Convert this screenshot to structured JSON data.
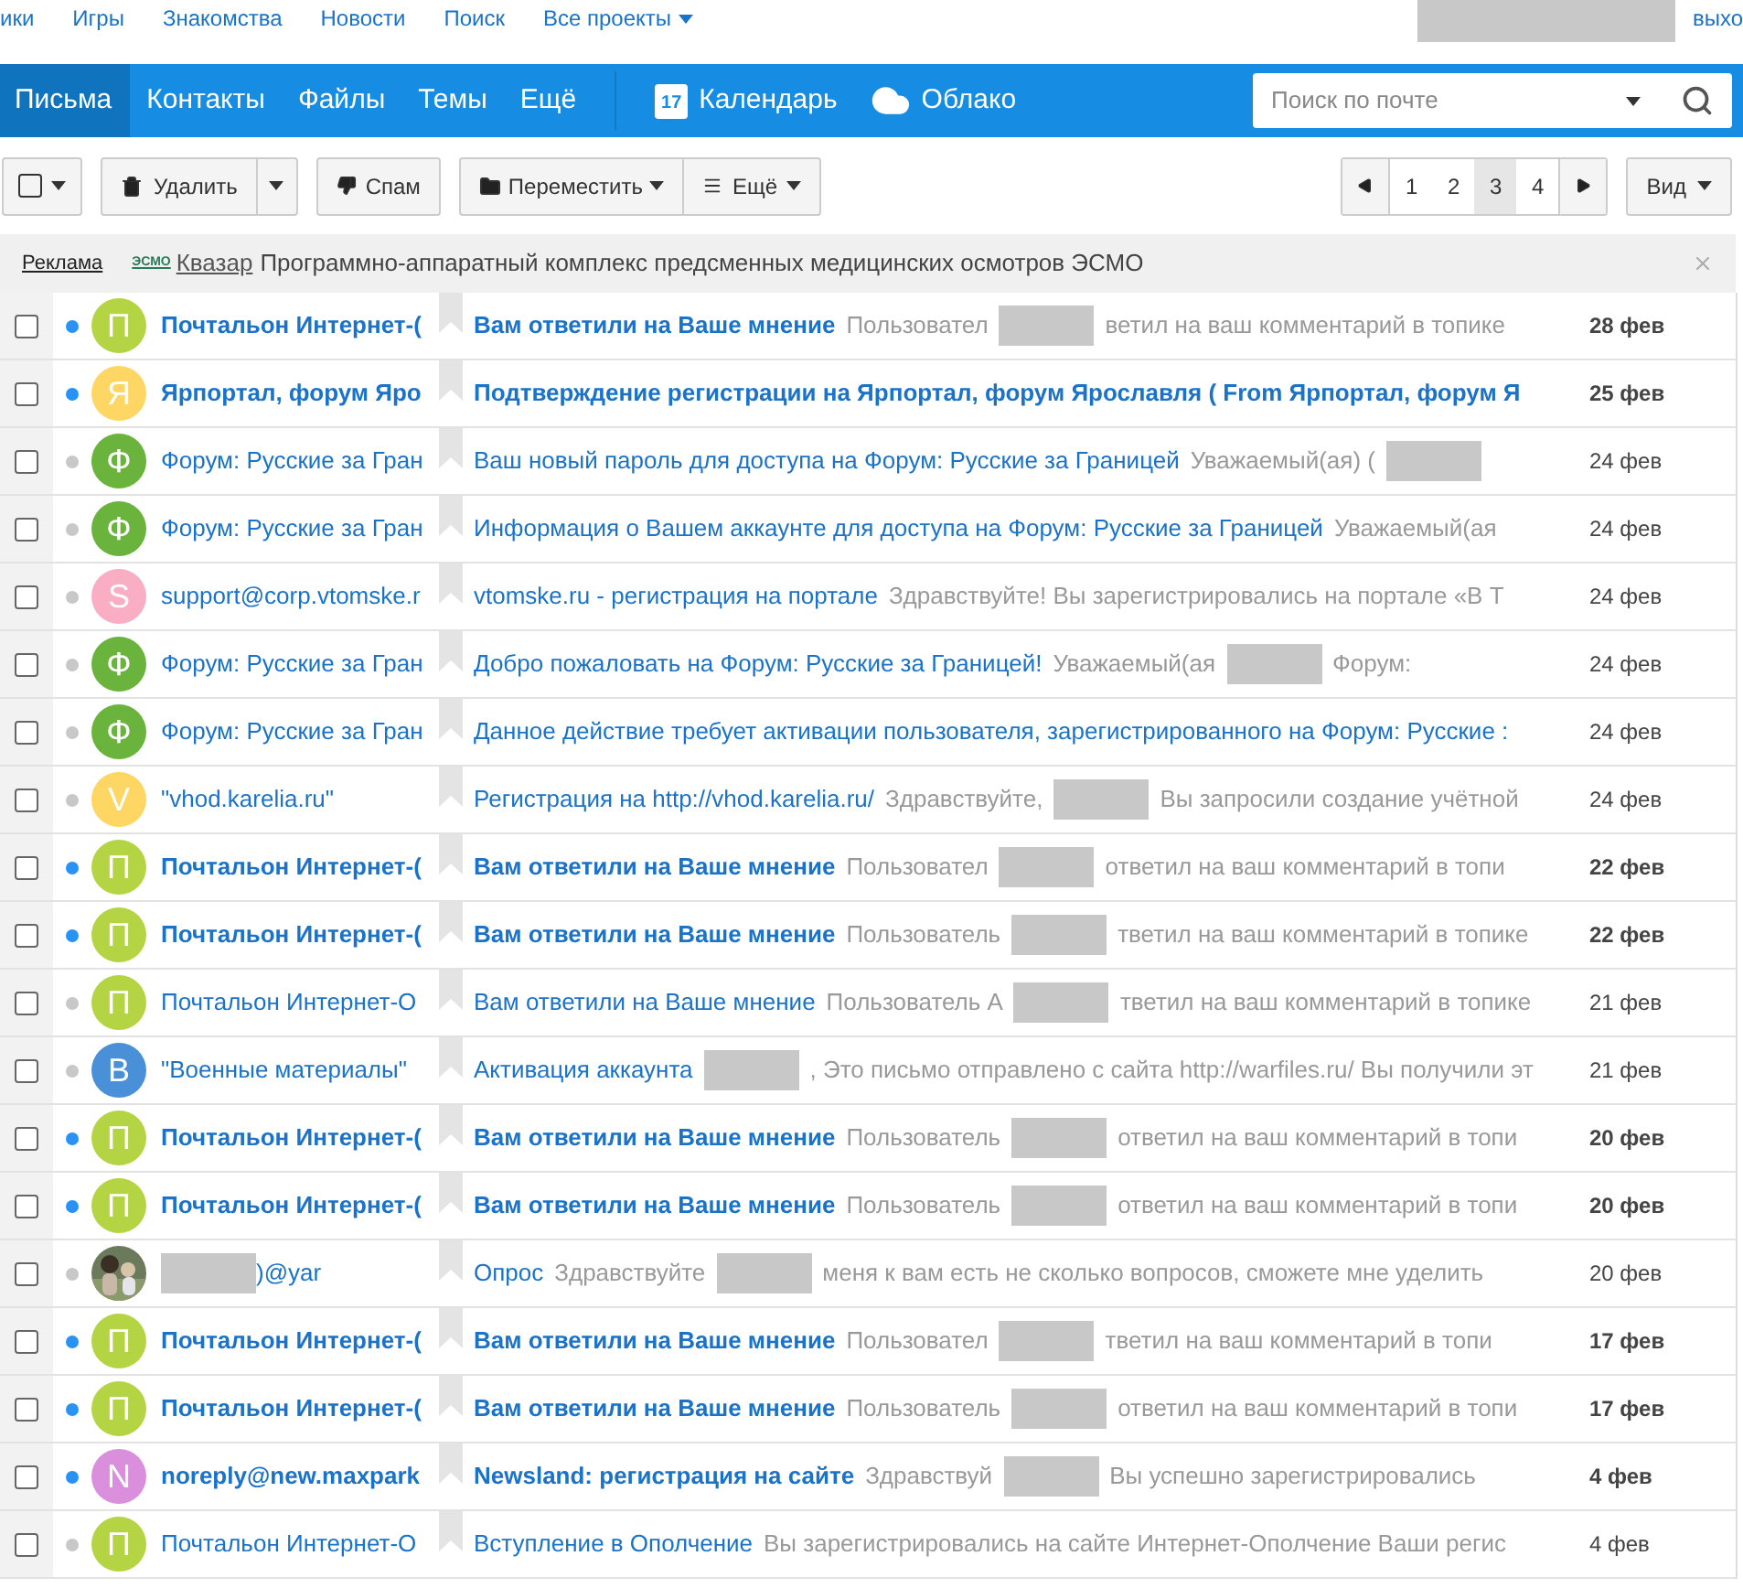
{
  "top_links": [
    "ики",
    "Игры",
    "Знакомства",
    "Новости",
    "Поиск"
  ],
  "all_projects": "Все проекты",
  "logout": "выхо",
  "nav": [
    {
      "label": "Письма",
      "selected": true
    },
    {
      "label": "Контакты",
      "selected": false
    },
    {
      "label": "Файлы",
      "selected": false
    },
    {
      "label": "Темы",
      "selected": false
    },
    {
      "label": "Ещё",
      "selected": false
    }
  ],
  "calendar": {
    "day": "17",
    "label": "Календарь"
  },
  "cloud": "Облако",
  "search": {
    "placeholder": "Поиск по почте"
  },
  "toolbar": {
    "delete": "Удалить",
    "spam": "Спам",
    "move": "Переместить",
    "more": "Ещё",
    "view": "Вид"
  },
  "pages": [
    {
      "label": "1",
      "selected": false
    },
    {
      "label": "2",
      "selected": false
    },
    {
      "label": "3",
      "selected": true
    },
    {
      "label": "4",
      "selected": false
    }
  ],
  "ad": {
    "label": "Реклама",
    "logo": "ЭСМО",
    "link": "Квазар",
    "text": "Программно-аппаратный комплекс предсменных медицинских осмотров ЭСМО"
  },
  "messages": [
    {
      "checked": false,
      "unread": true,
      "avatar": {
        "kind": "letter",
        "letter": "П",
        "color": "#b5d443"
      },
      "sender": [
        {
          "kind": "text",
          "text": "Почтальон Интернет-("
        }
      ],
      "subject": "Вам ответили на Ваше мнение",
      "preview": [
        {
          "kind": "text",
          "text": "Пользовател"
        },
        {
          "kind": "redacted"
        },
        {
          "kind": "text",
          "text": "ветил на ваш комментарий в топике"
        }
      ],
      "date": "28 фев"
    },
    {
      "checked": false,
      "unread": true,
      "avatar": {
        "kind": "letter",
        "letter": "Я",
        "color": "#fdd663"
      },
      "sender": [
        {
          "kind": "text",
          "text": "Ярпортал, форум Яро"
        }
      ],
      "subject": "Подтверждение регистрации на Ярпортал, форум Ярославля ( From Ярпортал, форум Я",
      "date": "25 фев"
    },
    {
      "checked": false,
      "unread": false,
      "avatar": {
        "kind": "letter",
        "letter": "Ф",
        "color": "#6ab43e"
      },
      "sender": [
        {
          "kind": "text",
          "text": "Форум: Русские за Гран"
        }
      ],
      "subject": "Ваш новый пароль для доступа на Форум: Русские за Границей",
      "preview": [
        {
          "kind": "text",
          "text": "Уважаемый(ая) ("
        },
        {
          "kind": "redacted"
        }
      ],
      "date": "24 фев"
    },
    {
      "checked": false,
      "unread": false,
      "avatar": {
        "kind": "letter",
        "letter": "Ф",
        "color": "#6ab43e"
      },
      "sender": [
        {
          "kind": "text",
          "text": "Форум: Русские за Гран"
        }
      ],
      "subject": "Информация о Вашем аккаунте для доступа на Форум: Русские за Границей",
      "preview": [
        {
          "kind": "text",
          "text": "Уважаемый(ая"
        }
      ],
      "date": "24 фев"
    },
    {
      "checked": false,
      "unread": false,
      "avatar": {
        "kind": "letter",
        "letter": "S",
        "color": "#f9aec4"
      },
      "sender": [
        {
          "kind": "text",
          "text": "support@corp.vtomske.r"
        }
      ],
      "subject": "vtomske.ru - регистрация на портале",
      "preview": [
        {
          "kind": "text",
          "text": "Здравствуйте! Вы зарегистрировались на портале «В Т"
        }
      ],
      "date": "24 фев"
    },
    {
      "checked": false,
      "unread": false,
      "avatar": {
        "kind": "letter",
        "letter": "Ф",
        "color": "#6ab43e"
      },
      "sender": [
        {
          "kind": "text",
          "text": "Форум: Русские за Гран"
        }
      ],
      "subject": "Добро пожаловать на Форум: Русские за Границей!",
      "preview": [
        {
          "kind": "text",
          "text": "Уважаемый(ая"
        },
        {
          "kind": "redacted"
        },
        {
          "kind": "text",
          "text": "Форум:"
        }
      ],
      "date": "24 фев"
    },
    {
      "checked": false,
      "unread": false,
      "avatar": {
        "kind": "letter",
        "letter": "Ф",
        "color": "#6ab43e"
      },
      "sender": [
        {
          "kind": "text",
          "text": "Форум: Русские за Гран"
        }
      ],
      "subject": "Данное действие требует активации пользователя, зарегистрированного на Форум: Русские :",
      "date": "24 фев"
    },
    {
      "checked": false,
      "unread": false,
      "avatar": {
        "kind": "letter",
        "letter": "V",
        "color": "#fdd663"
      },
      "sender": [
        {
          "kind": "text",
          "text": "\"vhod.karelia.ru\""
        }
      ],
      "subject": "Регистрация на http://vhod.karelia.ru/",
      "preview": [
        {
          "kind": "text",
          "text": "Здравствуйте,"
        },
        {
          "kind": "redacted"
        },
        {
          "kind": "text",
          "text": "Вы запросили создание учётной"
        }
      ],
      "date": "24 фев"
    },
    {
      "checked": false,
      "unread": true,
      "avatar": {
        "kind": "letter",
        "letter": "П",
        "color": "#b5d443"
      },
      "sender": [
        {
          "kind": "text",
          "text": "Почтальон Интернет-("
        }
      ],
      "subject": "Вам ответили на Ваше мнение",
      "preview": [
        {
          "kind": "text",
          "text": "Пользовател"
        },
        {
          "kind": "redacted"
        },
        {
          "kind": "text",
          "text": "ответил на ваш комментарий в топи"
        }
      ],
      "date": "22 фев"
    },
    {
      "checked": false,
      "unread": true,
      "avatar": {
        "kind": "letter",
        "letter": "П",
        "color": "#b5d443"
      },
      "sender": [
        {
          "kind": "text",
          "text": "Почтальон Интернет-("
        }
      ],
      "subject": "Вам ответили на Ваше мнение",
      "preview": [
        {
          "kind": "text",
          "text": "Пользователь"
        },
        {
          "kind": "redacted"
        },
        {
          "kind": "text",
          "text": "тветил на ваш комментарий в топике"
        }
      ],
      "date": "22 фев"
    },
    {
      "checked": false,
      "unread": false,
      "avatar": {
        "kind": "letter",
        "letter": "П",
        "color": "#b5d443"
      },
      "sender": [
        {
          "kind": "text",
          "text": "Почтальон Интернет-О"
        }
      ],
      "subject": "Вам ответили на Ваше мнение",
      "preview": [
        {
          "kind": "text",
          "text": "Пользователь А"
        },
        {
          "kind": "redacted"
        },
        {
          "kind": "text",
          "text": "тветил на ваш комментарий в топике"
        }
      ],
      "date": "21 фев"
    },
    {
      "checked": false,
      "unread": false,
      "avatar": {
        "kind": "letter",
        "letter": "В",
        "color": "#4a90d9"
      },
      "sender": [
        {
          "kind": "text",
          "text": "\"Военные материалы\""
        }
      ],
      "subject": "Активация аккаунта",
      "preview": [
        {
          "kind": "redacted"
        },
        {
          "kind": "text",
          "text": ", Это письмо отправлено с сайта http://warfiles.ru/ Вы получили эт"
        }
      ],
      "date": "21 фев"
    },
    {
      "checked": false,
      "unread": true,
      "avatar": {
        "kind": "letter",
        "letter": "П",
        "color": "#b5d443"
      },
      "sender": [
        {
          "kind": "text",
          "text": "Почтальон Интернет-("
        }
      ],
      "subject": "Вам ответили на Ваше мнение",
      "preview": [
        {
          "kind": "text",
          "text": "Пользователь"
        },
        {
          "kind": "redacted"
        },
        {
          "kind": "text",
          "text": "ответил на ваш комментарий в топи"
        }
      ],
      "date": "20 фев"
    },
    {
      "checked": false,
      "unread": true,
      "avatar": {
        "kind": "letter",
        "letter": "П",
        "color": "#b5d443"
      },
      "sender": [
        {
          "kind": "text",
          "text": "Почтальон Интернет-("
        }
      ],
      "subject": "Вам ответили на Ваше мнение",
      "preview": [
        {
          "kind": "text",
          "text": "Пользователь"
        },
        {
          "kind": "redacted"
        },
        {
          "kind": "text",
          "text": "ответил на ваш комментарий в топи"
        }
      ],
      "date": "20 фев"
    },
    {
      "checked": false,
      "unread": false,
      "avatar": {
        "kind": "picture"
      },
      "sender": [
        {
          "kind": "redacted"
        },
        {
          "kind": "text",
          "text": ")@yar"
        }
      ],
      "subject": "Опрос",
      "preview": [
        {
          "kind": "text",
          "text": "Здравствуйте"
        },
        {
          "kind": "redacted"
        },
        {
          "kind": "text",
          "text": "меня к вам есть не сколько вопросов, сможете мне уделить"
        }
      ],
      "date": "20 фев"
    },
    {
      "checked": false,
      "unread": true,
      "avatar": {
        "kind": "letter",
        "letter": "П",
        "color": "#b5d443"
      },
      "sender": [
        {
          "kind": "text",
          "text": "Почтальон Интернет-("
        }
      ],
      "subject": "Вам ответили на Ваше мнение",
      "preview": [
        {
          "kind": "text",
          "text": "Пользовател"
        },
        {
          "kind": "redacted"
        },
        {
          "kind": "text",
          "text": "тветил на ваш комментарий в топи"
        }
      ],
      "date": "17 фев"
    },
    {
      "checked": false,
      "unread": true,
      "avatar": {
        "kind": "letter",
        "letter": "П",
        "color": "#b5d443"
      },
      "sender": [
        {
          "kind": "text",
          "text": "Почтальон Интернет-("
        }
      ],
      "subject": "Вам ответили на Ваше мнение",
      "preview": [
        {
          "kind": "text",
          "text": "Пользователь"
        },
        {
          "kind": "redacted"
        },
        {
          "kind": "text",
          "text": "ответил на ваш комментарий в топи"
        }
      ],
      "date": "17 фев"
    },
    {
      "checked": false,
      "unread": true,
      "avatar": {
        "kind": "letter",
        "letter": "N",
        "color": "#d98fdc"
      },
      "sender": [
        {
          "kind": "text",
          "text": "noreply@new.maxpark"
        }
      ],
      "subject": "Newsland: регистрация на сайте",
      "preview": [
        {
          "kind": "text",
          "text": "Здравствуй"
        },
        {
          "kind": "redacted"
        },
        {
          "kind": "text",
          "text": "Вы успешно зарегистрировались"
        }
      ],
      "date": "4 фев"
    },
    {
      "checked": false,
      "unread": false,
      "avatar": {
        "kind": "letter",
        "letter": "П",
        "color": "#b5d443"
      },
      "sender": [
        {
          "kind": "text",
          "text": "Почтальон Интернет-О"
        }
      ],
      "subject": "Вступление в Ополчение",
      "preview": [
        {
          "kind": "text",
          "text": "Вы зарегистрировались на сайте Интернет-Ополчение Ваши регис"
        }
      ],
      "date": "4 фев"
    }
  ]
}
